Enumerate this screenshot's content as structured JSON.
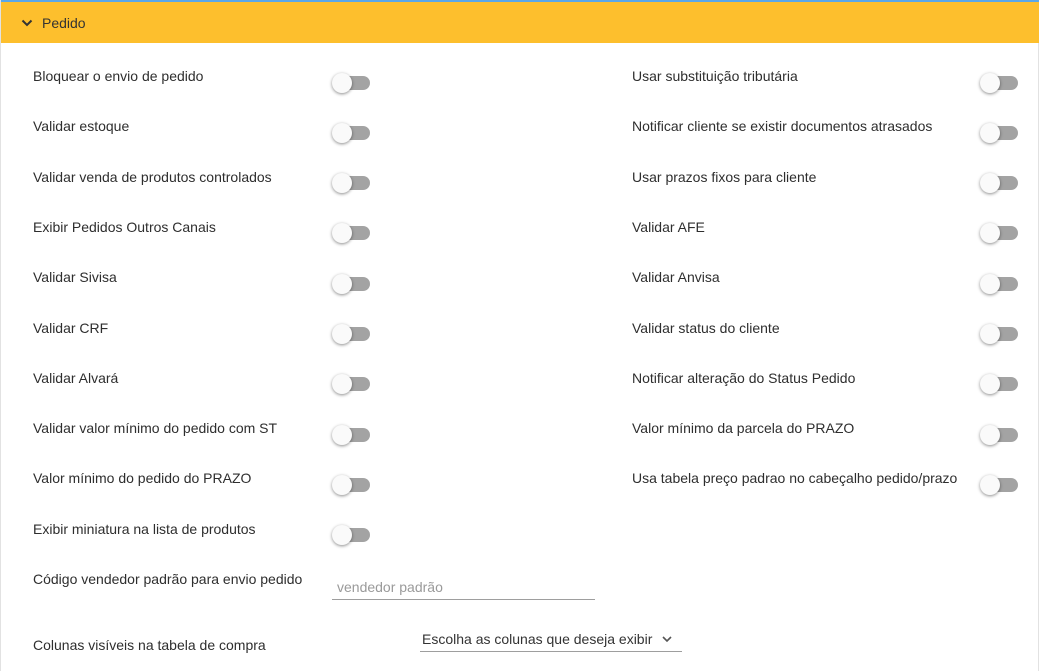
{
  "panel": {
    "title": "Pedido"
  },
  "left_settings": [
    {
      "label": "Bloquear o envio de pedido",
      "enabled": false
    },
    {
      "label": "Validar estoque",
      "enabled": false
    },
    {
      "label": "Validar venda de produtos controlados",
      "enabled": false
    },
    {
      "label": "Exibir Pedidos Outros Canais",
      "enabled": false
    },
    {
      "label": "Validar Sivisa",
      "enabled": false
    },
    {
      "label": "Validar CRF",
      "enabled": false
    },
    {
      "label": "Validar Alvará",
      "enabled": false
    },
    {
      "label": "Validar valor mínimo do pedido com ST",
      "enabled": false
    },
    {
      "label": "Valor mínimo do pedido do PRAZO",
      "enabled": false
    },
    {
      "label": "Exibir miniatura na lista de produtos",
      "enabled": false
    }
  ],
  "right_settings": [
    {
      "label": "Usar substituição tributária",
      "enabled": false
    },
    {
      "label": "Notificar cliente se existir documentos atrasados",
      "enabled": false
    },
    {
      "label": "Usar prazos fixos para cliente",
      "enabled": false
    },
    {
      "label": "Validar AFE",
      "enabled": false
    },
    {
      "label": "Validar Anvisa",
      "enabled": false
    },
    {
      "label": "Validar status do cliente",
      "enabled": false
    },
    {
      "label": "Notificar alteração do Status Pedido",
      "enabled": false
    },
    {
      "label": "Valor mínimo da parcela do PRAZO",
      "enabled": false
    },
    {
      "label": "Usa tabela preço padrao no cabeçalho pedido/prazo",
      "enabled": false
    }
  ],
  "vendor_code": {
    "label": "Código vendedor padrão para envio pedido",
    "value": "",
    "placeholder": "vendedor padrão"
  },
  "visible_columns": {
    "label": "Colunas visíveis na tabela de compra",
    "selected": "Escolha as colunas que deseja exibir"
  },
  "colors": {
    "header_bg": "#fdbf2d",
    "header_top_border": "#5aa7e8",
    "toggle_track_off": "#a3a3a3",
    "toggle_thumb_off": "#fafafa"
  },
  "icons": {
    "header_toggle": "chevron-down-icon",
    "select_arrow": "chevron-down-icon"
  }
}
